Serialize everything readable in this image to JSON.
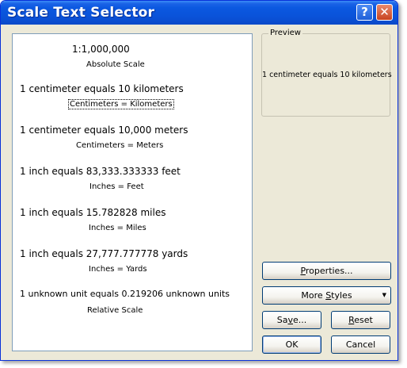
{
  "window": {
    "title": "Scale Text Selector"
  },
  "titlebar": {
    "help_glyph": "?",
    "close_glyph": "✕"
  },
  "styles": [
    {
      "scale_text": "1:1,000,000",
      "name": "Absolute Scale"
    },
    {
      "scale_text": "1 centimeter equals 10 kilometers",
      "name": "Centimeters = Kilometers",
      "selected": true
    },
    {
      "scale_text": "1 centimeter equals 10,000 meters",
      "name": "Centimeters = Meters"
    },
    {
      "scale_text": "1 inch equals 83,333.333333 feet",
      "name": "Inches = Feet"
    },
    {
      "scale_text": "1 inch equals 15.782828 miles",
      "name": "Inches = Miles"
    },
    {
      "scale_text": "1 inch equals 27,777.777778 yards",
      "name": "Inches = Yards"
    },
    {
      "scale_text": "1 unknown unit equals 0.219206 unknown units",
      "name": "Relative Scale"
    }
  ],
  "preview": {
    "label": "Preview",
    "text": "1 centimeter equals 10 kilometers"
  },
  "buttons": {
    "properties": {
      "pre": "",
      "key": "P",
      "post": "roperties..."
    },
    "more_styles": {
      "pre": "More ",
      "key": "S",
      "post": "tyles",
      "arrow": "▼"
    },
    "save": {
      "pre": "Sa",
      "key": "v",
      "post": "e..."
    },
    "reset": {
      "pre": "",
      "key": "R",
      "post": "eset"
    },
    "ok": {
      "label": "OK"
    },
    "cancel": {
      "label": "Cancel"
    }
  }
}
